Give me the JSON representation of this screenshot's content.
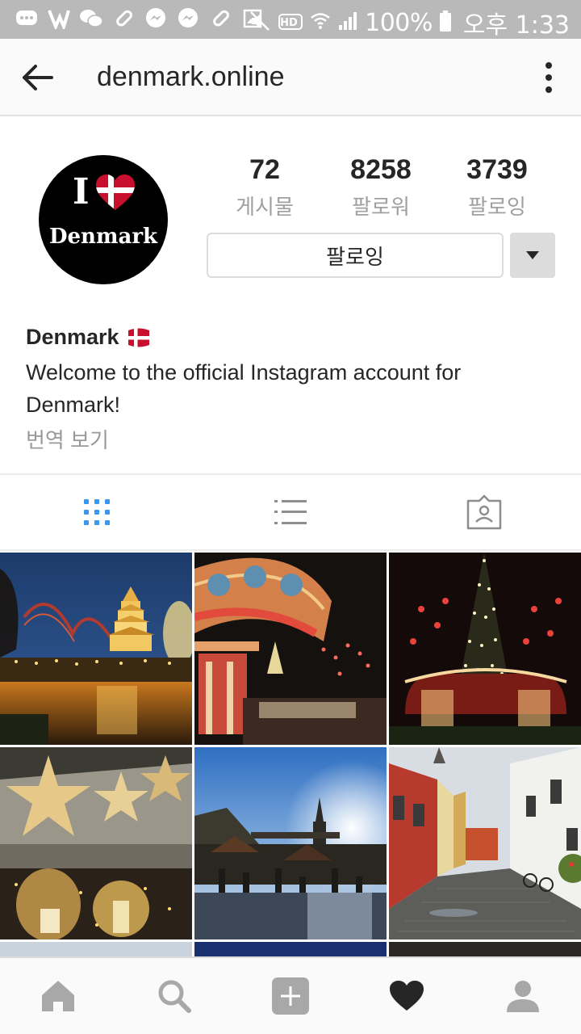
{
  "status_bar": {
    "battery": "100%",
    "time": "오후 1:33",
    "hd": "HD",
    "left_icons": [
      "chat-bubble-icon",
      "v-app-icon",
      "wechat-icon",
      "pill-icon",
      "messenger-icon",
      "messenger-icon",
      "pill-icon",
      "gallery-icon"
    ],
    "right_icons": [
      "mute-icon",
      "hd-call-icon",
      "wifi-icon",
      "signal-icon",
      "battery-icon"
    ]
  },
  "header": {
    "title": "denmark.online",
    "back_icon": "arrow-left-icon",
    "menu_icon": "more-vertical-icon"
  },
  "profile": {
    "avatar_text_i": "I",
    "avatar_text_name": "Denmark",
    "stats": [
      {
        "value": "72",
        "label": "게시물"
      },
      {
        "value": "8258",
        "label": "팔로워"
      },
      {
        "value": "3739",
        "label": "팔로잉"
      }
    ],
    "follow_button_label": "팔로잉",
    "bio_name": "Denmark",
    "bio_text": "Welcome to the official Instagram account for Denmark!",
    "translate_label": "번역 보기"
  },
  "tabs": [
    "grid-icon",
    "list-icon",
    "tagged-icon"
  ],
  "grid": {
    "photos": [
      {
        "name": "photo-tivoli-pagoda-night"
      },
      {
        "name": "photo-tivoli-carousel"
      },
      {
        "name": "photo-christmas-tree-lights"
      },
      {
        "name": "photo-star-lanterns"
      },
      {
        "name": "photo-christmas-market"
      },
      {
        "name": "photo-cobblestone-street"
      }
    ]
  },
  "bottom_nav": [
    "home-icon",
    "search-icon",
    "add-post-icon",
    "activity-heart-icon",
    "profile-icon"
  ],
  "colors": {
    "accent_blue": "#3897f0",
    "text_dark": "#262626",
    "text_muted": "#999999",
    "danish_red": "#c8102e"
  }
}
